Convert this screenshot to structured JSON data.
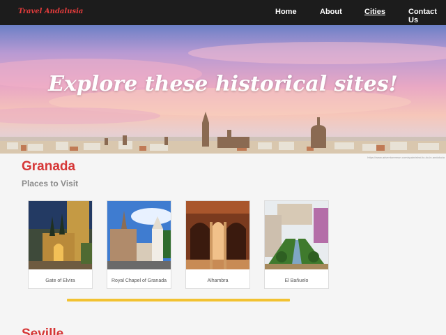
{
  "nav": {
    "brand": "Travel Andalusia",
    "links": [
      "Home",
      "About",
      "Cities",
      "Contact Us"
    ],
    "active": "Cities"
  },
  "hero": {
    "title": "Explore these historical sites!",
    "credit": "https://www.adventurerman.com/spain/what-to-do-in-andalucia"
  },
  "city": {
    "name": "Granada",
    "subtitle": "Places to Visit",
    "places": [
      {
        "caption": "Gate of Elvira"
      },
      {
        "caption": "Royal Chapel of Granada"
      },
      {
        "caption": "Alhambra"
      },
      {
        "caption": "El Bañuelo"
      }
    ]
  },
  "next_city": {
    "name": "Seville"
  },
  "colors": {
    "accent": "#d63636",
    "divider": "#f2c232",
    "nav_bg": "#1c1c1c"
  }
}
